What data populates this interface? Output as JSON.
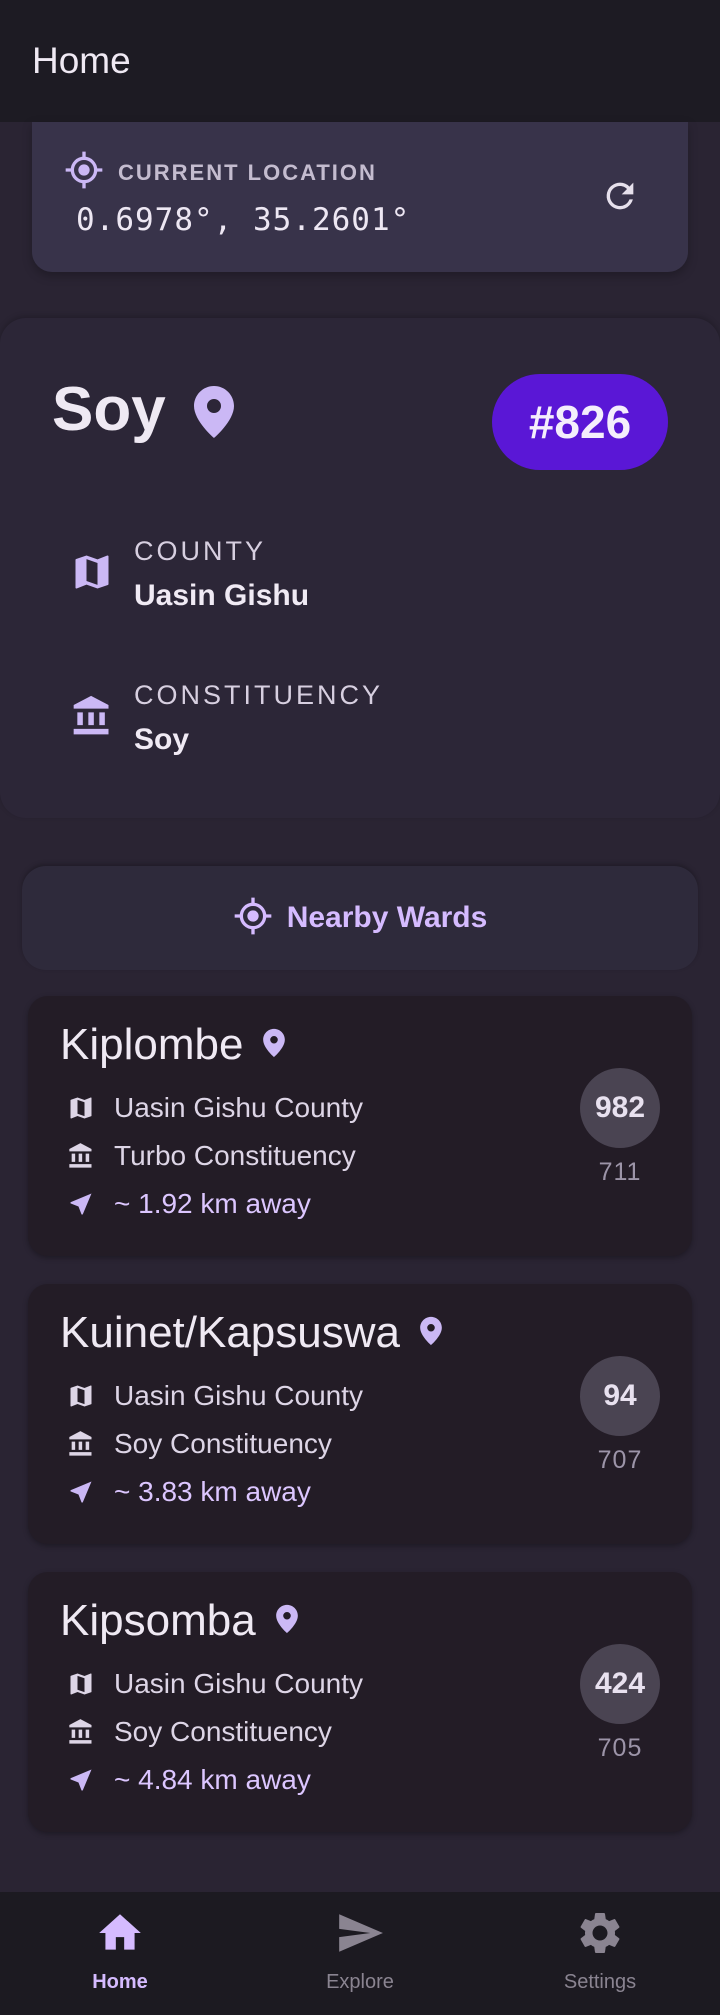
{
  "appbar": {
    "title": "Home"
  },
  "location": {
    "label": "CURRENT LOCATION",
    "coords": "0.6978°, 35.2601°"
  },
  "ward": {
    "name": "Soy",
    "badge": "#826",
    "county_label": "COUNTY",
    "county": "Uasin Gishu",
    "constituency_label": "CONSTITUENCY",
    "constituency": "Soy"
  },
  "nearby": {
    "label": "Nearby Wards"
  },
  "wards": [
    {
      "name": "Kiplombe",
      "county": "Uasin Gishu County",
      "constituency": "Turbo Constituency",
      "distance": "~ 1.92 km away",
      "code": "982",
      "sub": "711"
    },
    {
      "name": "Kuinet/Kapsuswa",
      "county": "Uasin Gishu County",
      "constituency": "Soy Constituency",
      "distance": "~ 3.83 km away",
      "code": "94",
      "sub": "707"
    },
    {
      "name": "Kipsomba",
      "county": "Uasin Gishu County",
      "constituency": "Soy Constituency",
      "distance": "~ 4.84 km away",
      "code": "424",
      "sub": "705"
    }
  ],
  "nav": [
    {
      "label": "Home",
      "icon": "home-icon",
      "active": true
    },
    {
      "label": "Explore",
      "icon": "send-icon",
      "active": false
    },
    {
      "label": "Settings",
      "icon": "gear-icon",
      "active": false
    }
  ],
  "colors": {
    "accent": "#d5bbff",
    "badge": "#5a17d6",
    "background": "#2a2433"
  }
}
